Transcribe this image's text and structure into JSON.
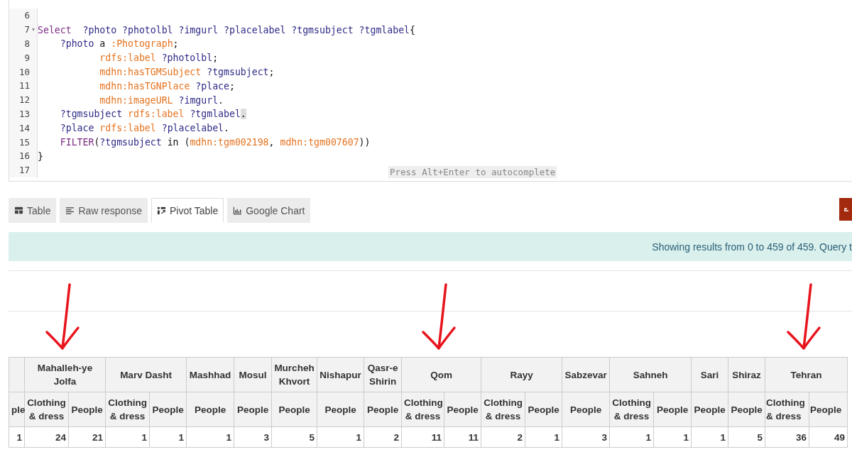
{
  "editor": {
    "lines": [
      {
        "number": "6",
        "foldable": false
      },
      {
        "number": "7",
        "foldable": true,
        "segments": [
          {
            "kind": "keyword",
            "text": "Select"
          },
          {
            "kind": "variable",
            "text": "  ?photo ?photolbl ?imgurl ?placelabel ?tgmsubject ?tgmlabel"
          },
          {
            "kind": "plain",
            "text": "{"
          }
        ]
      },
      {
        "number": "8",
        "foldable": false,
        "segments": [
          {
            "kind": "variable",
            "text": "    ?photo"
          },
          {
            "kind": "plain",
            "text": " a"
          },
          {
            "kind": "iri",
            "text": " :Photograph"
          },
          {
            "kind": "plain",
            "text": ";"
          }
        ]
      },
      {
        "number": "9",
        "foldable": false,
        "segments": [
          {
            "kind": "iri",
            "text": "           rdfs:label"
          },
          {
            "kind": "variable",
            "text": " ?photolbl"
          },
          {
            "kind": "plain",
            "text": ";"
          }
        ]
      },
      {
        "number": "10",
        "foldable": false,
        "segments": [
          {
            "kind": "iri",
            "text": "           mdhn:hasTGMSubject"
          },
          {
            "kind": "variable",
            "text": " ?tgmsubject"
          },
          {
            "kind": "plain",
            "text": ";"
          }
        ]
      },
      {
        "number": "11",
        "foldable": false,
        "segments": [
          {
            "kind": "iri",
            "text": "           mdhn:hasTGNPlace"
          },
          {
            "kind": "variable",
            "text": " ?place"
          },
          {
            "kind": "plain",
            "text": ";"
          }
        ]
      },
      {
        "number": "12",
        "foldable": false,
        "segments": [
          {
            "kind": "iri",
            "text": "           mdhn:imageURL"
          },
          {
            "kind": "variable",
            "text": " ?imgurl"
          },
          {
            "kind": "plain",
            "text": "."
          }
        ]
      },
      {
        "number": "13",
        "foldable": false,
        "segments": [
          {
            "kind": "variable",
            "text": "    ?tgmsubject"
          },
          {
            "kind": "iri",
            "text": " rdfs:label"
          },
          {
            "kind": "variable",
            "text": " ?tgmlabel"
          },
          {
            "kind": "cursor",
            "text": "."
          }
        ]
      },
      {
        "number": "14",
        "foldable": false,
        "segments": [
          {
            "kind": "variable",
            "text": "    ?place"
          },
          {
            "kind": "iri",
            "text": " rdfs:label"
          },
          {
            "kind": "variable",
            "text": " ?placelabel"
          },
          {
            "kind": "plain",
            "text": "."
          }
        ]
      },
      {
        "number": "15",
        "foldable": false,
        "segments": [
          {
            "kind": "keyword",
            "text": "    FILTER"
          },
          {
            "kind": "plain",
            "text": "("
          },
          {
            "kind": "variable",
            "text": "?tgmsubject"
          },
          {
            "kind": "plain",
            "text": " in ("
          },
          {
            "kind": "iri",
            "text": "mdhn:tgm002198"
          },
          {
            "kind": "plain",
            "text": ","
          },
          {
            "kind": "iri",
            "text": " mdhn:tgm007607"
          },
          {
            "kind": "plain",
            "text": "))"
          }
        ]
      },
      {
        "number": "16",
        "foldable": false,
        "segments": [
          {
            "kind": "plain",
            "text": "}"
          }
        ]
      },
      {
        "number": "17",
        "foldable": false
      }
    ],
    "hint": "Press Alt+Enter to autocomplete"
  },
  "tabs": [
    {
      "label": "Table",
      "kind": "table",
      "selected": false
    },
    {
      "label": "Raw response",
      "kind": "raw",
      "selected": false
    },
    {
      "label": "Pivot Table",
      "kind": "pivot",
      "selected": true
    },
    {
      "label": "Google Chart",
      "kind": "chart",
      "selected": false
    }
  ],
  "status": "Showing results from 0 to 459 of 459. Query t",
  "pivot": {
    "groups": [
      {
        "marked": false,
        "columns": [
          {
            "label": "ple",
            "value": "1"
          }
        ]
      },
      {
        "place": "Mahalleh-ye Jolfa",
        "marked": true,
        "columns": [
          {
            "label": "Clothing & dress",
            "value": "24"
          },
          {
            "label": "People",
            "value": "21"
          }
        ]
      },
      {
        "place": "Marv Dasht",
        "marked": false,
        "columns": [
          {
            "label": "Clothing & dress",
            "value": "1"
          },
          {
            "label": "People",
            "value": "1"
          }
        ]
      },
      {
        "place": "Mashhad",
        "marked": false,
        "columns": [
          {
            "label": "People",
            "value": "1"
          }
        ]
      },
      {
        "place": "Mosul",
        "marked": false,
        "columns": [
          {
            "label": "People",
            "value": "3"
          }
        ]
      },
      {
        "place": "Murcheh Khvort",
        "marked": false,
        "columns": [
          {
            "label": "People",
            "value": "5"
          }
        ]
      },
      {
        "place": "Nishapur",
        "marked": false,
        "columns": [
          {
            "label": "People",
            "value": "1"
          }
        ]
      },
      {
        "place": "Qasr-e Shirin",
        "marked": false,
        "columns": [
          {
            "label": "People",
            "value": "2"
          }
        ]
      },
      {
        "place": "Qom",
        "marked": true,
        "columns": [
          {
            "label": "Clothing & dress",
            "value": "11"
          },
          {
            "label": "People",
            "value": "11"
          }
        ]
      },
      {
        "place": "Rayy",
        "marked": false,
        "columns": [
          {
            "label": "Clothing & dress",
            "value": "2"
          },
          {
            "label": "People",
            "value": "1"
          }
        ]
      },
      {
        "place": "Sabzevar",
        "marked": false,
        "columns": [
          {
            "label": "People",
            "value": "3"
          }
        ]
      },
      {
        "place": "Sahneh",
        "marked": false,
        "columns": [
          {
            "label": "Clothing & dress",
            "value": "1"
          },
          {
            "label": "People",
            "value": "1"
          }
        ]
      },
      {
        "place": "Sari",
        "marked": false,
        "columns": [
          {
            "label": "People",
            "value": "1"
          }
        ]
      },
      {
        "place": "Shiraz",
        "marked": false,
        "columns": [
          {
            "label": "People",
            "value": "5"
          }
        ]
      },
      {
        "place": "Tehran",
        "marked": true,
        "columns": [
          {
            "label": "Clothing & dress",
            "value": "36"
          },
          {
            "label": "People",
            "value": "49"
          }
        ]
      }
    ]
  }
}
